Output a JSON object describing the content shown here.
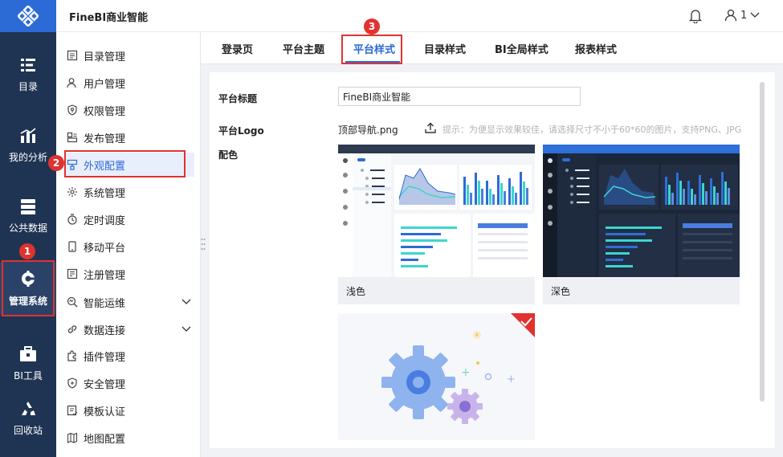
{
  "header": {
    "brand": "FineBI商业智能",
    "user_label": "1"
  },
  "rail": {
    "items": [
      {
        "label": "目录"
      },
      {
        "label": "我的分析"
      },
      {
        "label": "公共数据"
      },
      {
        "label": "管理系统"
      },
      {
        "label": "BI工具"
      },
      {
        "label": "回收站"
      }
    ]
  },
  "sidebar": {
    "items": [
      {
        "label": "目录管理",
        "icon": "catalog-icon"
      },
      {
        "label": "用户管理",
        "icon": "user-icon"
      },
      {
        "label": "权限管理",
        "icon": "shield-key-icon"
      },
      {
        "label": "发布管理",
        "icon": "publish-icon"
      },
      {
        "label": "外观配置",
        "icon": "appearance-icon"
      },
      {
        "label": "系统管理",
        "icon": "gear-icon"
      },
      {
        "label": "定时调度",
        "icon": "timer-icon"
      },
      {
        "label": "移动平台",
        "icon": "mobile-icon"
      },
      {
        "label": "注册管理",
        "icon": "register-icon"
      },
      {
        "label": "智能运维",
        "icon": "ops-icon"
      },
      {
        "label": "数据连接",
        "icon": "link-icon"
      },
      {
        "label": "插件管理",
        "icon": "plugin-icon"
      },
      {
        "label": "安全管理",
        "icon": "security-icon"
      },
      {
        "label": "模板认证",
        "icon": "template-icon"
      },
      {
        "label": "地图配置",
        "icon": "map-icon"
      }
    ]
  },
  "tabs": [
    "登录页",
    "平台主题",
    "平台样式",
    "目录样式",
    "BI全局样式",
    "报表样式"
  ],
  "form": {
    "title_label": "平台标题",
    "title_value": "FineBI商业智能",
    "logo_label": "平台Logo",
    "logo_filename": "顶部导航.png",
    "logo_hint": "提示：为便显示效果较佳，请选择尺寸不小于60*60的图片，支持PNG、JPG",
    "color_label": "配色",
    "theme_light": "浅色",
    "theme_dark": "深色"
  },
  "annotations": {
    "step1": "1",
    "step2": "2",
    "step3": "3"
  },
  "colors": {
    "rail": "#1f3453",
    "accent": "#2c6bd6",
    "annotation": "#e0322f"
  }
}
